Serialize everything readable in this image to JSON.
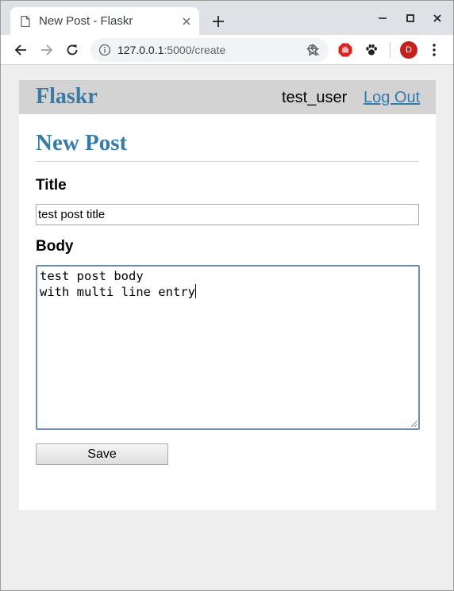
{
  "browser": {
    "tab": {
      "title": "New Post - Flaskr"
    },
    "url": {
      "host": "127.0.0.1",
      "rest": ":5000/create"
    },
    "profile_initial": "D",
    "icons": [
      "page-icon",
      "close-icon",
      "plus-icon",
      "minimize-icon",
      "maximize-icon",
      "window-close-icon",
      "back-icon",
      "forward-icon",
      "reload-icon",
      "info-icon",
      "zoom-icon",
      "star-icon",
      "adblock-icon",
      "extension-paw-icon",
      "menu-dots-icon"
    ]
  },
  "app": {
    "brand": "Flaskr",
    "user": "test_user",
    "logout_label": "Log Out",
    "colors": {
      "accent": "#377ba8",
      "nav_bg": "#d3d3d3"
    }
  },
  "form": {
    "heading": "New Post",
    "title_label": "Title",
    "title_value": "test post title",
    "body_label": "Body",
    "body_lines": [
      "test post body",
      "with multi line entry"
    ],
    "save_label": "Save"
  }
}
